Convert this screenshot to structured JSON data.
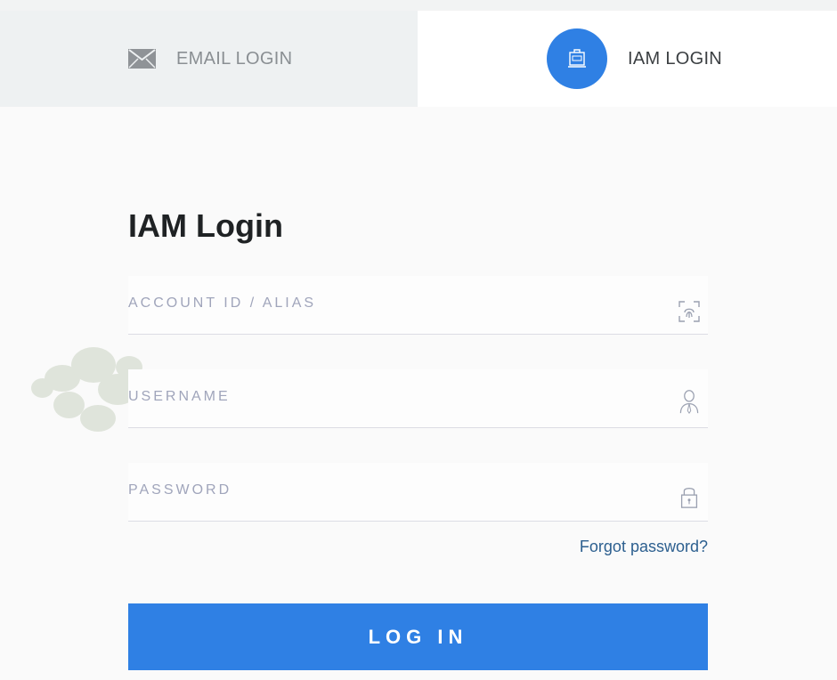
{
  "tabs": {
    "email": {
      "label": "EMAIL LOGIN",
      "icon": "mail-icon"
    },
    "iam": {
      "label": "IAM LOGIN",
      "icon": "iam-terminal-icon",
      "active": true
    }
  },
  "form": {
    "title": "IAM Login",
    "account": {
      "placeholder": "ACCOUNT ID / ALIAS",
      "value": "",
      "icon": "fingerprint-scan-icon"
    },
    "username": {
      "placeholder": "USERNAME",
      "value": "",
      "icon": "user-icon"
    },
    "password": {
      "placeholder": "PASSWORD",
      "value": "",
      "icon": "lock-icon"
    },
    "forgot_label": "Forgot password?",
    "login_label": "LOG IN"
  },
  "colors": {
    "accent": "#2f80e4",
    "link": "#2c5f8f",
    "placeholder": "#a0a5bb",
    "inactive_tab_bg": "#eef1f2"
  }
}
